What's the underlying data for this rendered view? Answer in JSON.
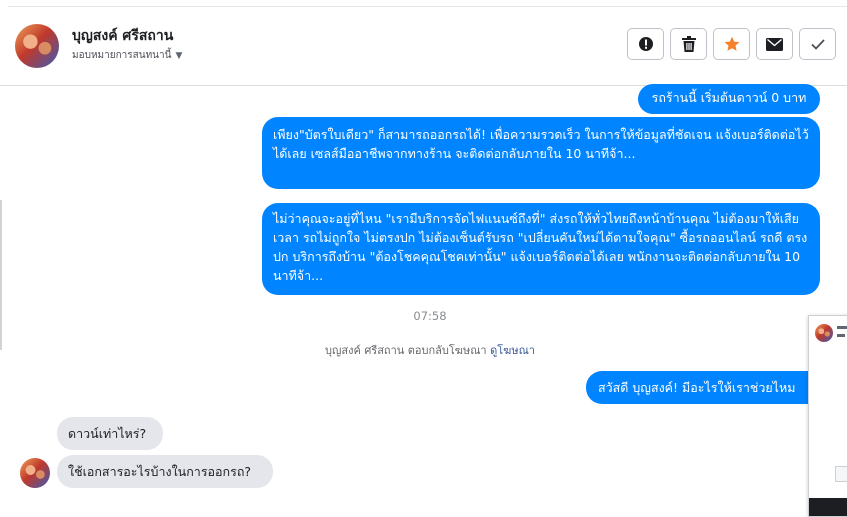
{
  "header": {
    "name": "บุญสงค์ ศรีสถาน",
    "assign": "มอบหมายการสนทนานี้"
  },
  "messages": {
    "out1": "รถร้านนี้ เริ่มต้นดาวน์ 0 บาท",
    "out2": "เพียง\"บัตรใบเดียว\" ก็สามารถออกรถได้! เพื่อความรวดเร็ว ในการให้ข้อมูลที่ชัดเจน แจ้งเบอร์ติดต่อไว้ได้เลย เซลส์มืออาชีพจากทางร้าน จะติดต่อกลับภายใน 10 นาทีจ้า...",
    "out3": "ไม่ว่าคุณจะอยู่ที่ไหน \"เรามีบริการจัดไฟแนนซ์ถึงที่\"  ส่งรถให้ทั่วไทยถึงหน้าบ้านคุณ ไม่ต้องมาให้เสียเวลา รถไม่ถูกใจ ไม่ตรงปก ไม่ต้องเซ็นต์รับรถ \"เปลี่ยนคันใหม่ได้ตามใจคุณ\" ซื้อรถออนไลน์ รถดี ตรงปก บริการถึงบ้าน \"ต้องโชคคุณโชคเท่านั้น\" แจ้งเบอร์ติดต่อได้เลย พนักงานจะติดต่อกลับภายใน 10 นาทีจ้า...",
    "time": "07:58",
    "reply_text": "บุญสงค์ ศรีสถาน ตอบกลับโฆษณา",
    "reply_link": "ดูโฆษณา",
    "out4": "สวัสดี บุญสงค์! มีอะไรให้เราช่วยไหม",
    "in1": "ดาวน์เท่าไหร่?",
    "in2": "ใช้เอกสารอะไรบ้างในการออกรถ?"
  },
  "icons": {
    "report": "exclamation-icon",
    "delete": "trash-icon",
    "star": "star-icon",
    "mark_unread": "envelope-icon",
    "done": "check-icon"
  },
  "colors": {
    "outgoing_bubble": "#0084ff",
    "incoming_bubble": "#e4e6eb",
    "star": "#f5822a",
    "link": "#385898"
  }
}
